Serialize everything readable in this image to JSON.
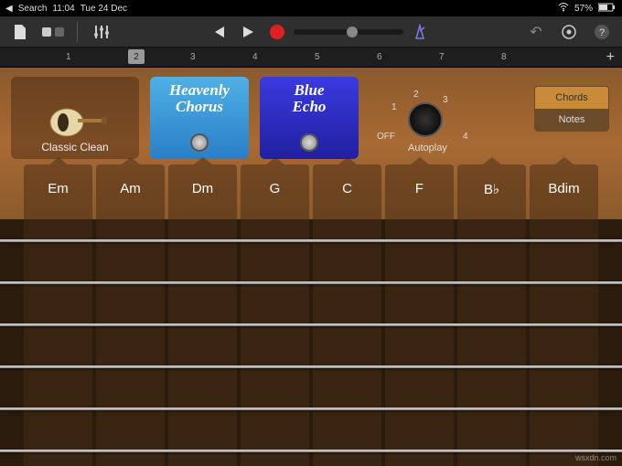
{
  "status": {
    "back": "Search",
    "time": "11:04",
    "date": "Tue 24 Dec",
    "battery": "57%"
  },
  "ruler": {
    "ticks": [
      "1",
      "2",
      "3",
      "4",
      "5",
      "6",
      "7",
      "8"
    ],
    "playhead": "2"
  },
  "preset": {
    "label": "Classic Clean"
  },
  "pedals": {
    "chorus_line1": "Heavenly",
    "chorus_line2": "Chorus",
    "echo_line1": "Blue",
    "echo_line2": "Echo"
  },
  "autoplay": {
    "off": "OFF",
    "p1": "1",
    "p2": "2",
    "p3": "3",
    "p4": "4",
    "label": "Autoplay"
  },
  "segmented": {
    "chords": "Chords",
    "notes": "Notes"
  },
  "chords": [
    "Em",
    "Am",
    "Dm",
    "G",
    "C",
    "F",
    "B♭",
    "Bdim"
  ],
  "watermark": "wsxdn.com"
}
